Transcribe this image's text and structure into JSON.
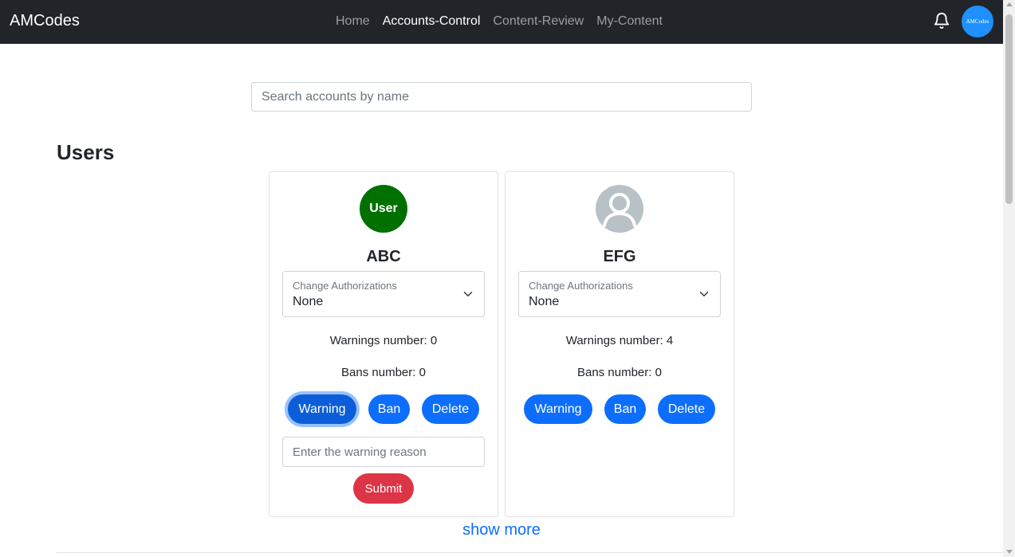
{
  "navbar": {
    "brand": "AMCodes",
    "links": [
      {
        "label": "Home",
        "active": false
      },
      {
        "label": "Accounts-Control",
        "active": true
      },
      {
        "label": "Content-Review",
        "active": false
      },
      {
        "label": "My-Content",
        "active": false
      }
    ],
    "bell_icon": "bell-icon",
    "avatar_text": "AMCodes",
    "avatar_color": "#1e90ff"
  },
  "search": {
    "placeholder": "Search accounts by name",
    "value": ""
  },
  "section_title": "Users",
  "users": [
    {
      "name": "ABC",
      "avatar_text": "User",
      "avatar_color": "#007000",
      "authorization_label": "Change Authorizations",
      "authorization_value": "None",
      "warnings_text": "Warnings number: 0",
      "bans_text": "Bans number: 0",
      "warning_label": "Warning",
      "ban_label": "Ban",
      "delete_label": "Delete",
      "reason_placeholder": "Enter the warning reason",
      "submit_label": "Submit"
    },
    {
      "name": "EFG",
      "avatar_icon": "default-user-icon",
      "authorization_label": "Change Authorizations",
      "authorization_value": "None",
      "warnings_text": "Warnings number: 4",
      "bans_text": "Bans number: 0",
      "warning_label": "Warning",
      "ban_label": "Ban",
      "delete_label": "Delete"
    }
  ],
  "show_more": "show more",
  "colors": {
    "primary": "#0d6efd",
    "danger": "#dc3545",
    "navbar": "#212529"
  }
}
